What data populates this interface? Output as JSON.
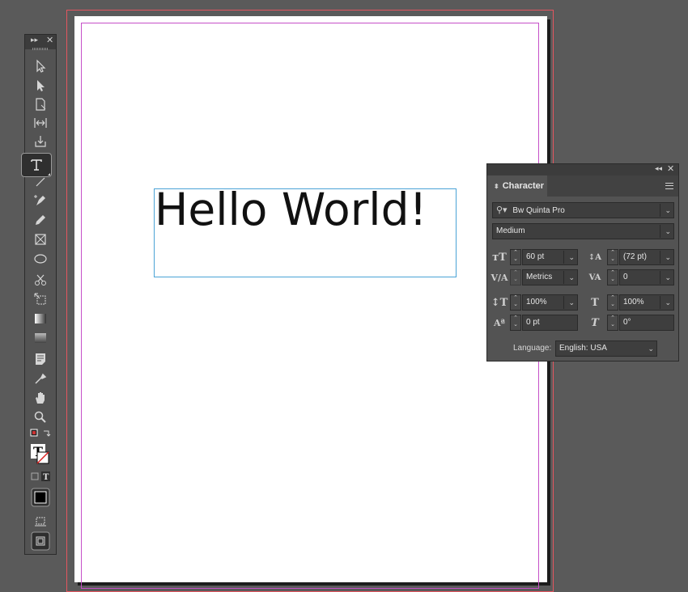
{
  "document": {
    "frame_text": "Hello World!"
  },
  "tools_panel": {
    "collapse_icon": "double-chevron-icon",
    "close_icon": "close-icon"
  },
  "character_panel": {
    "tab_label": "Character",
    "font_family": "Bw Quinta Pro",
    "font_style": "Medium",
    "font_size": "60 pt",
    "leading": "(72 pt)",
    "kerning": "Metrics",
    "tracking": "0",
    "vertical_scale": "100%",
    "horizontal_scale": "100%",
    "baseline_shift": "0 pt",
    "skew": "0°",
    "language_label": "Language:",
    "language": "English: USA"
  }
}
